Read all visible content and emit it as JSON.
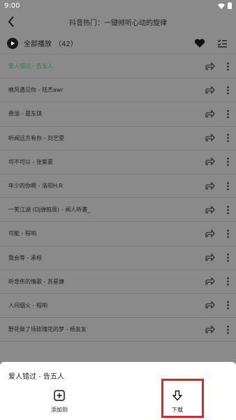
{
  "status": {
    "time": "9:00"
  },
  "header": {
    "title": "抖音热门：一键倾听心动的旋律"
  },
  "playall": {
    "label": "全部播放",
    "count": "（42）"
  },
  "songs": [
    {
      "title": "爱人错过 - 告五人",
      "active": true
    },
    {
      "title": "晚风遇见你 - 陆杰awr"
    },
    {
      "title": "悬溺 - 葛东琪"
    },
    {
      "title": "听闻远方有你 - 刘艺雯"
    },
    {
      "title": "可不可以 - 张紫豪"
    },
    {
      "title": "年少的你啊 - 洛阳H.R"
    },
    {
      "title": "一笑江湖 (DJ弹鼓版) - 闻人听書_"
    },
    {
      "title": "可能 - 程响"
    },
    {
      "title": "我会等 - 承桓"
    },
    {
      "title": "听悲伤的情歌 - 苏星婕"
    },
    {
      "title": "人间烟火 - 程响"
    },
    {
      "title": "野花做了场玫瑰花的梦 - 杨友友"
    }
  ],
  "sheet": {
    "song": "爱人错过 - 告五人",
    "add_label": "添加到",
    "download_label": "下载"
  },
  "colors": {
    "active_song": "#2f7a4f",
    "highlight": "#d92626"
  }
}
